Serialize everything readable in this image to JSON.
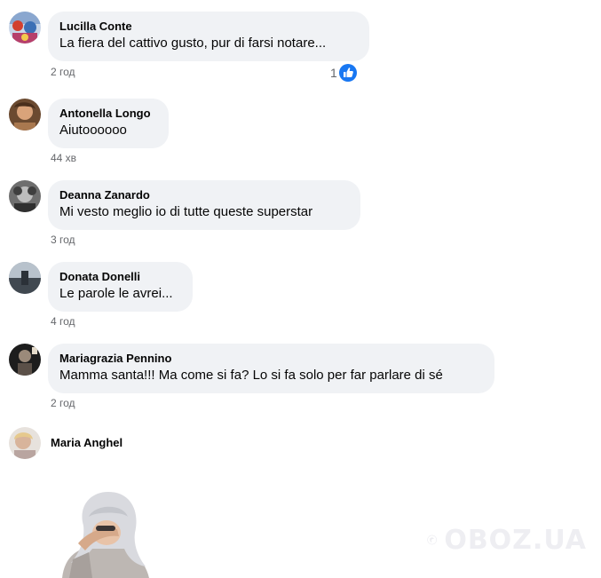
{
  "comments": [
    {
      "author": "Lucilla Conte",
      "text": "La fiera del cattivo gusto, pur di farsi notare...",
      "time": "2 год",
      "reactions": {
        "count": "1",
        "icon": "like-icon",
        "color": "#1877f2"
      }
    },
    {
      "author": "Antonella Longo",
      "text": "Aiutoooooo",
      "time": "44 хв"
    },
    {
      "author": "Deanna Zanardo",
      "text": "Mi vesto meglio io di tutte queste superstar",
      "time": "3 год"
    },
    {
      "author": "Donata Donelli",
      "text": "Le parole le avrei...",
      "time": "4 год"
    },
    {
      "author": "Mariagrazia Pennino",
      "text": "Mamma santa!!! Ma come si fa? Lo si fa solo per far parlare di sé",
      "time": "2 год"
    },
    {
      "author": "Maria Anghel"
    }
  ],
  "watermark": {
    "text": "OBOZ.UA"
  },
  "colors": {
    "bubble": "#f0f2f5",
    "secondary_text": "#65676b",
    "like_blue": "#1877f2"
  }
}
